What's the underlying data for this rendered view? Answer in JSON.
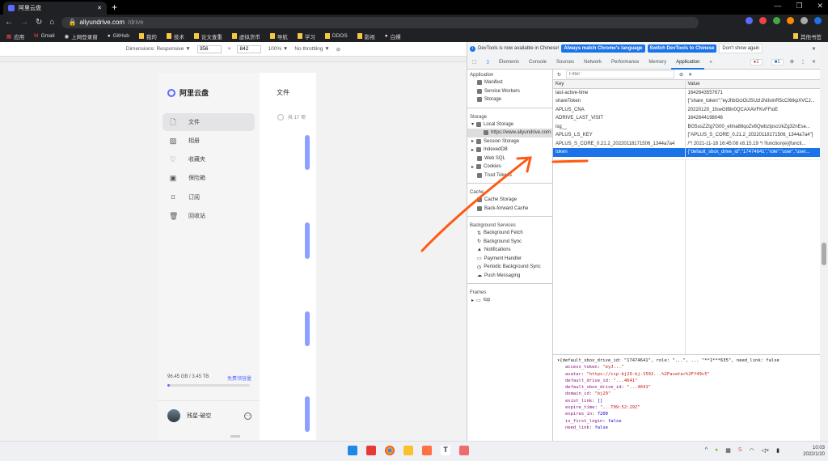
{
  "browser": {
    "tab_title": "阿里云盘",
    "url_host": "aliyundrive.com",
    "url_path": "/drive",
    "bookmarks": [
      "应用",
      "Gmail",
      "上网登录窗",
      "GitHub",
      "我的",
      "技术",
      "论文查重",
      "虚拟货币",
      "导航",
      "学习",
      "DDOS",
      "影视",
      "白嫖"
    ],
    "other_bookmarks": "其他书签"
  },
  "device_toolbar": {
    "dimensions": "Dimensions: Responsive ▼",
    "width": "356",
    "height": "842",
    "x": "×",
    "zoom": "100% ▼",
    "throttling": "No throttling ▼"
  },
  "app": {
    "logo": "阿里云盘",
    "nav": [
      {
        "label": "文件",
        "icon": "file-icon",
        "g": "🗋"
      },
      {
        "label": "相册",
        "icon": "photo-icon",
        "g": "▨"
      },
      {
        "label": "收藏夹",
        "icon": "heart-icon",
        "g": "♡"
      },
      {
        "label": "保险箱",
        "icon": "safe-icon",
        "g": "▣"
      },
      {
        "label": "订阅",
        "icon": "bookmark-icon",
        "g": "⌑"
      },
      {
        "label": "回收站",
        "icon": "trash-icon",
        "g": "🗑"
      }
    ],
    "main_title": "文件",
    "count": "共 17 项",
    "quota": "96.45 GB / 3.45 TB",
    "quota_link": "免费领容量",
    "quota_used": 0.03,
    "user": "残星-破空",
    "accent": "#5a6bff"
  },
  "devtools": {
    "banner": {
      "text": "DevTools is now available in Chinese!",
      "btn1": "Always match Chrome's language",
      "btn2": "Switch DevTools to Chinese",
      "btn3": "Don't show again"
    },
    "tabs": [
      "Elements",
      "Console",
      "Sources",
      "Network",
      "Performance",
      "Memory",
      "Application",
      "»"
    ],
    "errors": "1",
    "messages": "1",
    "sidebar": {
      "application": "Application",
      "app_items": [
        "Manifest",
        "Service Workers",
        "Storage"
      ],
      "storage": "Storage",
      "local_storage": "Local Storage",
      "origin": "https://www.aliyundrive.com",
      "storage_items": [
        "Session Storage",
        "IndexedDB",
        "Web SQL",
        "Cookies",
        "Trust Tokens"
      ],
      "cache": "Cache",
      "cache_items": [
        "Cache Storage",
        "Back-forward Cache"
      ],
      "bg": "Background Services",
      "bg_items": [
        "Background Fetch",
        "Background Sync",
        "Notifications",
        "Payment Handler",
        "Periodic Background Sync",
        "Push Messaging"
      ],
      "frames": "Frames",
      "frame_top": "top"
    },
    "filter_placeholder": "Filter",
    "col_key": "Key",
    "col_value": "Value",
    "rows": [
      {
        "k": "last-active-time",
        "v": "1642643557671"
      },
      {
        "k": "shareToken",
        "v": "{\"share_token\":\"eyJhbGciOiJSUzI1NiIsInR5cCI6IkpXVCJ..."
      },
      {
        "k": "APLUS_CNA",
        "v": "20220120_1fswGtf8n0QCAXAVFKvFFioE"
      },
      {
        "k": "ADRIVE_LAST_VISIT",
        "v": "1642644198046"
      },
      {
        "k": "isg__",
        "v": "BG5usZZtg7G00_eIIna88qoZv8QwbzIpscUkZg32nEse..."
      },
      {
        "k": "APLUS_LS_KEY",
        "v": "[\"APLUS_S_CORE_0.21.2_20220118171506_1344a7a4\"]"
      },
      {
        "k": "APLUS_S_CORE_0.21.2_20220118171506_1344a7a4",
        "v": "/*! 2021-11-18 16:45:08 v8.15.19 */ !function(e){functi..."
      },
      {
        "k": "token",
        "v": "{\"default_sbox_drive_id\":\"17474641\",\"role\":\"user\",\"user..."
      }
    ],
    "preview": {
      "head": "▾{default_sbox_drive_id: \"17474641\", role: \"...\", ... \"**1***635\", need_link: false",
      "lines": [
        {
          "k": "access_token",
          "v": "\"eyJ...\""
        },
        {
          "k": "avatar",
          "v": "\"https://ccp-bj29-bj-1592...%2Favatar%2Ff49c5\""
        },
        {
          "k": "default_drive_id",
          "v": "\"...4641\""
        },
        {
          "k": "default_sbox_drive_id",
          "v": "\"...4641\""
        },
        {
          "k": "domain_id",
          "v": "\"bj29\""
        },
        {
          "k": "exist_link",
          "v": "[]"
        },
        {
          "k": "expire_time",
          "v": "\"...T09:52:29Z\""
        },
        {
          "k": "expires_in",
          "v": "7200"
        },
        {
          "k": "is_first_login",
          "v": "false"
        },
        {
          "k": "need_link",
          "v": "false"
        }
      ]
    }
  },
  "taskbar": {
    "time": "10:03",
    "date": "2022/1/20"
  }
}
